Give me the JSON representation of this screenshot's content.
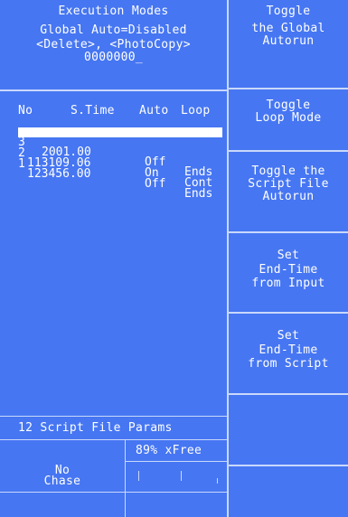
{
  "header": {
    "line1": "Execution Modes",
    "line2": "Global Auto=Disabled",
    "line3": "<Delete>, <PhotoCopy>",
    "line4": "0000000_"
  },
  "table": {
    "headers": {
      "no": "No",
      "time": "S.Time",
      "auto": "Auto",
      "loop": "Loop"
    },
    "rows": [
      {
        "no": "3",
        "time": "2001.00",
        "auto": "Off",
        "loop": "Ends",
        "selected": true
      },
      {
        "no": "2",
        "time": "113109.06",
        "auto": "On",
        "loop": "Cont",
        "selected": false
      },
      {
        "no": "1",
        "time": "123456.00",
        "auto": "Off",
        "loop": "Ends",
        "selected": false
      }
    ]
  },
  "footer": {
    "params": "12 Script File Params",
    "free": "89% xFree",
    "chase_line1": "No",
    "chase_line2": "Chase"
  },
  "buttons": [
    {
      "line1": "Toggle",
      "line2": "the Global",
      "line3": "Autorun"
    },
    {
      "line1": "Toggle",
      "line2": "Loop Mode"
    },
    {
      "line1": "Toggle the",
      "line2": "Script File",
      "line3": "Autorun"
    },
    {
      "line1": "Set",
      "line2": "End-Time",
      "line3": "from Input"
    },
    {
      "line1": "Set",
      "line2": "End-Time",
      "line3": "from Script"
    },
    {
      "line1": ""
    },
    {
      "line1": ""
    }
  ],
  "colors": {
    "panel": "#4676f2",
    "text": "#ffffff",
    "divider": "#c9d8fb"
  }
}
